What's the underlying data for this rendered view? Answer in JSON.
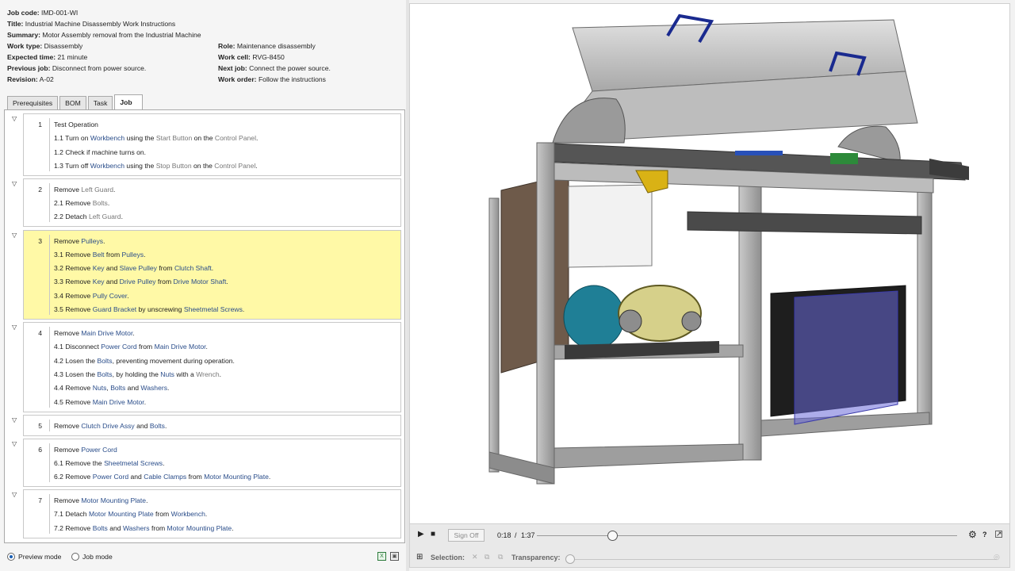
{
  "header": {
    "job_code": {
      "label": "Job code:",
      "value": "IMD-001-WI"
    },
    "title": {
      "label": "Title:",
      "value": "Industrial Machine Disassembly Work Instructions"
    },
    "summary": {
      "label": "Summary:",
      "value": "Motor Assembly removal from the Industrial Machine"
    },
    "work_type": {
      "label": "Work type:",
      "value": "Disassembly"
    },
    "role": {
      "label": "Role:",
      "value": "Maintenance disassembly"
    },
    "expected_time": {
      "label": "Expected time:",
      "value": "21 minute"
    },
    "work_cell": {
      "label": "Work cell:",
      "value": "RVG-8450"
    },
    "previous_job": {
      "label": "Previous job:",
      "value": "Disconnect from power source."
    },
    "next_job": {
      "label": "Next job:",
      "value": "Connect the power source."
    },
    "revision": {
      "label": "Revision:",
      "value": "A-02"
    },
    "work_order": {
      "label": "Work order:",
      "value": "Follow the instructions"
    }
  },
  "tabs": [
    {
      "label": "Prerequisites",
      "active": false
    },
    {
      "label": "BOM",
      "active": false
    },
    {
      "label": "Task",
      "active": false
    },
    {
      "label": "Job",
      "active": true
    }
  ],
  "steps": [
    {
      "num": "1",
      "highlighted": false,
      "lines": [
        [
          {
            "t": "Test Operation",
            "s": ""
          }
        ],
        [
          {
            "t": "1.1 Turn on ",
            "s": ""
          },
          {
            "t": "Workbench",
            "s": "k"
          },
          {
            "t": " using the ",
            "s": ""
          },
          {
            "t": "Start Button",
            "s": "g"
          },
          {
            "t": " on the ",
            "s": ""
          },
          {
            "t": "Control Panel",
            "s": "g"
          },
          {
            "t": ".",
            "s": ""
          }
        ],
        [
          {
            "t": "1.2 Check if machine turns on.",
            "s": ""
          }
        ],
        [
          {
            "t": "1.3 Turn off ",
            "s": ""
          },
          {
            "t": "Workbench",
            "s": "k"
          },
          {
            "t": " using the ",
            "s": ""
          },
          {
            "t": "Stop Button",
            "s": "g"
          },
          {
            "t": " on the ",
            "s": ""
          },
          {
            "t": "Control Panel",
            "s": "g"
          },
          {
            "t": ".",
            "s": ""
          }
        ]
      ]
    },
    {
      "num": "2",
      "highlighted": false,
      "lines": [
        [
          {
            "t": "Remove ",
            "s": ""
          },
          {
            "t": "Left Guard",
            "s": "g"
          },
          {
            "t": ".",
            "s": ""
          }
        ],
        [
          {
            "t": "2.1 Remove ",
            "s": ""
          },
          {
            "t": "Bolts",
            "s": "g"
          },
          {
            "t": ".",
            "s": ""
          }
        ],
        [
          {
            "t": "2.2 Detach ",
            "s": ""
          },
          {
            "t": "Left Guard",
            "s": "g"
          },
          {
            "t": ".",
            "s": ""
          }
        ]
      ]
    },
    {
      "num": "3",
      "highlighted": true,
      "lines": [
        [
          {
            "t": "Remove ",
            "s": ""
          },
          {
            "t": "Pulleys",
            "s": "k"
          },
          {
            "t": ".",
            "s": ""
          }
        ],
        [
          {
            "t": "3.1 Remove ",
            "s": ""
          },
          {
            "t": "Belt",
            "s": "k"
          },
          {
            "t": " from ",
            "s": ""
          },
          {
            "t": "Pulleys",
            "s": "k"
          },
          {
            "t": ".",
            "s": ""
          }
        ],
        [
          {
            "t": "3.2 Remove ",
            "s": ""
          },
          {
            "t": "Key",
            "s": "k"
          },
          {
            "t": " and ",
            "s": ""
          },
          {
            "t": "Slave Pulley",
            "s": "k"
          },
          {
            "t": " from ",
            "s": ""
          },
          {
            "t": "Clutch Shaft",
            "s": "k"
          },
          {
            "t": ".",
            "s": ""
          }
        ],
        [
          {
            "t": "3.3 Remove ",
            "s": ""
          },
          {
            "t": "Key",
            "s": "k"
          },
          {
            "t": " and ",
            "s": ""
          },
          {
            "t": "Drive Pulley",
            "s": "k"
          },
          {
            "t": " from ",
            "s": ""
          },
          {
            "t": "Drive Motor Shaft",
            "s": "k"
          },
          {
            "t": ".",
            "s": ""
          }
        ],
        [
          {
            "t": "3.4 Remove ",
            "s": ""
          },
          {
            "t": "Pully Cover",
            "s": "k"
          },
          {
            "t": ".",
            "s": ""
          }
        ],
        [
          {
            "t": "3.5 Remove ",
            "s": ""
          },
          {
            "t": "Guard Bracket",
            "s": "k"
          },
          {
            "t": " by unscrewing ",
            "s": ""
          },
          {
            "t": "Sheetmetal Screws",
            "s": "k"
          },
          {
            "t": ".",
            "s": ""
          }
        ]
      ]
    },
    {
      "num": "4",
      "highlighted": false,
      "lines": [
        [
          {
            "t": "Remove ",
            "s": ""
          },
          {
            "t": "Main Drive Motor",
            "s": "k"
          },
          {
            "t": ".",
            "s": ""
          }
        ],
        [
          {
            "t": "4.1 Disconnect ",
            "s": ""
          },
          {
            "t": "Power Cord",
            "s": "k"
          },
          {
            "t": " from ",
            "s": ""
          },
          {
            "t": "Main Drive Motor",
            "s": "k"
          },
          {
            "t": ".",
            "s": ""
          }
        ],
        [
          {
            "t": "4.2 Losen the ",
            "s": ""
          },
          {
            "t": "Bolts",
            "s": "k"
          },
          {
            "t": ", preventing movement during operation.",
            "s": ""
          }
        ],
        [
          {
            "t": "4.3 Losen the ",
            "s": ""
          },
          {
            "t": "Bolts",
            "s": "k"
          },
          {
            "t": ", by holding the ",
            "s": ""
          },
          {
            "t": "Nuts",
            "s": "k"
          },
          {
            "t": " with a ",
            "s": ""
          },
          {
            "t": "Wrench",
            "s": "g"
          },
          {
            "t": ".",
            "s": ""
          }
        ],
        [
          {
            "t": "4.4 Remove ",
            "s": ""
          },
          {
            "t": "Nuts",
            "s": "k"
          },
          {
            "t": ", ",
            "s": ""
          },
          {
            "t": "Bolts",
            "s": "k"
          },
          {
            "t": " and ",
            "s": ""
          },
          {
            "t": "Washers",
            "s": "k"
          },
          {
            "t": ".",
            "s": ""
          }
        ],
        [
          {
            "t": "4.5 Remove ",
            "s": ""
          },
          {
            "t": "Main Drive Motor",
            "s": "k"
          },
          {
            "t": ".",
            "s": ""
          }
        ]
      ]
    },
    {
      "num": "5",
      "highlighted": false,
      "lines": [
        [
          {
            "t": "Remove ",
            "s": ""
          },
          {
            "t": "Clutch Drive Assy",
            "s": "k"
          },
          {
            "t": " and ",
            "s": ""
          },
          {
            "t": "Bolts",
            "s": "k"
          },
          {
            "t": ".",
            "s": ""
          }
        ]
      ]
    },
    {
      "num": "6",
      "highlighted": false,
      "lines": [
        [
          {
            "t": "Remove ",
            "s": ""
          },
          {
            "t": "Power Cord",
            "s": "k"
          }
        ],
        [
          {
            "t": "6.1 Remove the ",
            "s": ""
          },
          {
            "t": "Sheetmetal Screws",
            "s": "k"
          },
          {
            "t": ".",
            "s": ""
          }
        ],
        [
          {
            "t": "6.2 Remove ",
            "s": ""
          },
          {
            "t": "Power Cord",
            "s": "k"
          },
          {
            "t": " and ",
            "s": ""
          },
          {
            "t": "Cable Clamps",
            "s": "k"
          },
          {
            "t": " from ",
            "s": ""
          },
          {
            "t": "Motor Mounting Plate",
            "s": "k"
          },
          {
            "t": ".",
            "s": ""
          }
        ]
      ]
    },
    {
      "num": "7",
      "highlighted": false,
      "lines": [
        [
          {
            "t": "Remove ",
            "s": ""
          },
          {
            "t": "Motor Mounting Plate",
            "s": "k"
          },
          {
            "t": ".",
            "s": ""
          }
        ],
        [
          {
            "t": "7.1 Detach ",
            "s": ""
          },
          {
            "t": "Motor Mounting Plate",
            "s": "k"
          },
          {
            "t": " from ",
            "s": ""
          },
          {
            "t": "Workbench",
            "s": "k"
          },
          {
            "t": ".",
            "s": ""
          }
        ],
        [
          {
            "t": "7.2 Remove ",
            "s": ""
          },
          {
            "t": "Bolts",
            "s": "k"
          },
          {
            "t": " and ",
            "s": ""
          },
          {
            "t": "Washers",
            "s": "k"
          },
          {
            "t": " from ",
            "s": ""
          },
          {
            "t": "Motor Mounting Plate",
            "s": "k"
          },
          {
            "t": ".",
            "s": ""
          }
        ]
      ]
    }
  ],
  "mode": {
    "preview_label": "Preview mode",
    "job_label": "Job mode",
    "selected": "preview"
  },
  "player": {
    "sign_off_label": "Sign Off",
    "current_time": "0:18",
    "separator": "/",
    "total_time": "1:37",
    "progress": 0.18,
    "selection_label": "Selection:",
    "transparency_label": "Transparency:",
    "help_label": "?"
  },
  "icons": {
    "play": "play-icon",
    "stop": "stop-icon",
    "settings": "gear-icon",
    "help": "help-icon",
    "popout": "popout-icon",
    "excel": "excel-icon"
  },
  "colors": {
    "highlight": "#fff9a6",
    "keyword_text": "#2a4d8a",
    "muted_text": "#777777",
    "accent": "#1a5fb4"
  }
}
